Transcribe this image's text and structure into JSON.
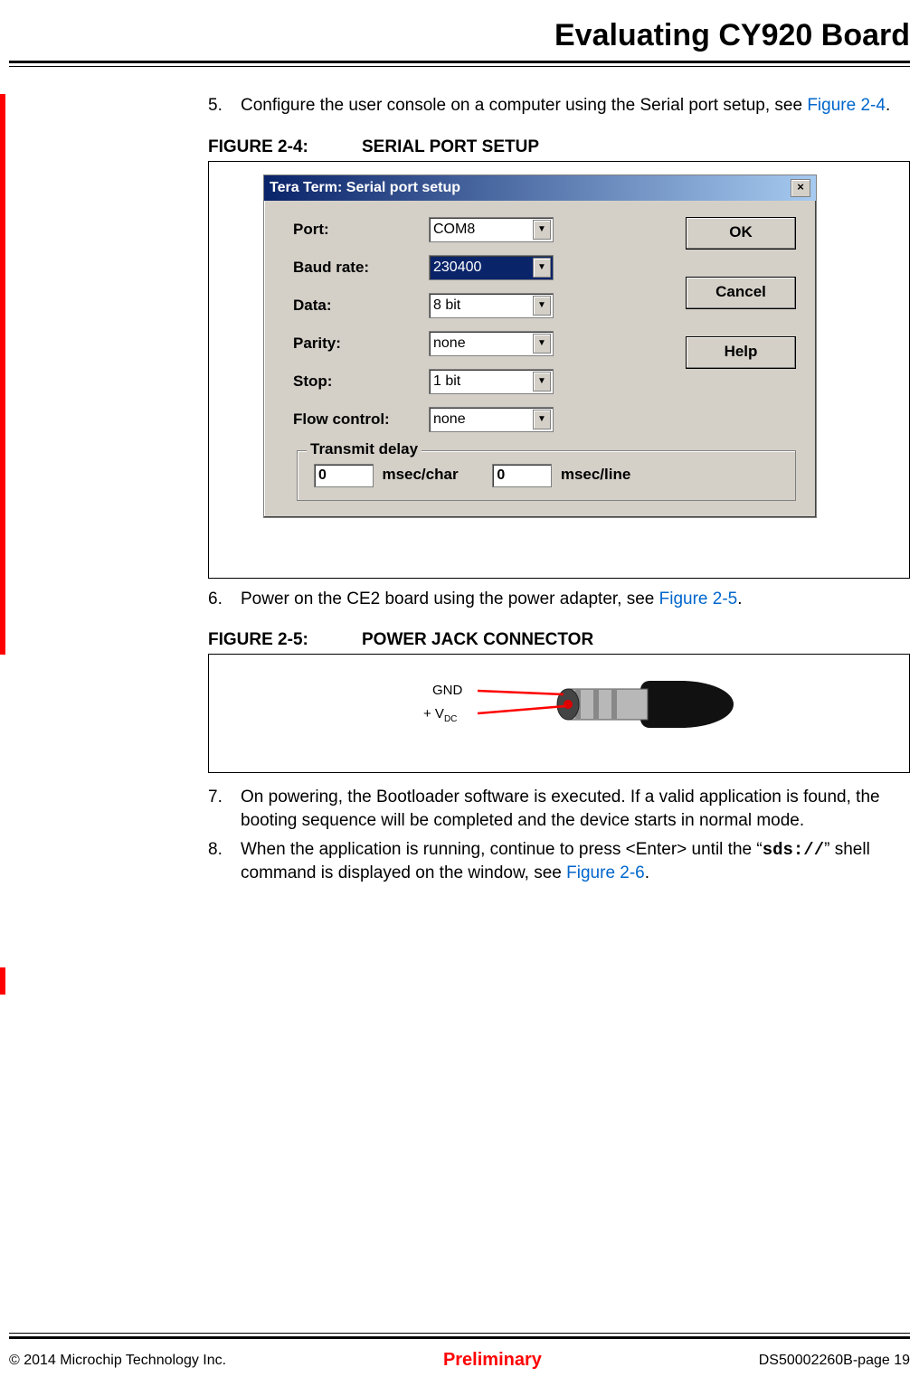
{
  "header": {
    "title": "Evaluating CY920 Board"
  },
  "steps": {
    "s5": {
      "num": "5.",
      "text_a": "Configure the user console on a computer using the Serial port setup, see ",
      "link": "Figure 2-4",
      "text_b": "."
    },
    "s6": {
      "num": "6.",
      "text_a": "Power on the CE2 board using the power adapter, see ",
      "link": "Figure 2-5",
      "text_b": "."
    },
    "s7": {
      "num": "7.",
      "text": "On powering, the Bootloader software is executed. If a valid application is found, the booting sequence will be completed and the device starts in normal mode."
    },
    "s8": {
      "num": "8.",
      "text_a": "When the application is running, continue to press <Enter> until the “",
      "code": "sds://",
      "text_b": "” shell command is displayed on the window, see ",
      "link": "Figure 2-6",
      "text_c": "."
    }
  },
  "figures": {
    "f24": {
      "label": "FIGURE 2-4:",
      "title": "SERIAL PORT SETUP"
    },
    "f25": {
      "label": "FIGURE 2-5:",
      "title": "POWER JACK CONNECTOR"
    }
  },
  "dialog": {
    "title": "Tera Term: Serial port setup",
    "close": "×",
    "labels": {
      "port": "Port:",
      "baud": "Baud rate:",
      "data": "Data:",
      "parity": "Parity:",
      "stop": "Stop:",
      "flow": "Flow control:"
    },
    "values": {
      "port": "COM8",
      "baud": "230400",
      "data": "8 bit",
      "parity": "none",
      "stop": "1 bit",
      "flow": "none"
    },
    "buttons": {
      "ok": "OK",
      "cancel": "Cancel",
      "help": "Help"
    },
    "fieldset": {
      "legend": "Transmit delay",
      "char_val": "0",
      "char_unit": "msec/char",
      "line_val": "0",
      "line_unit": "msec/line"
    }
  },
  "power_fig": {
    "gnd": "GND",
    "vdc": "+ V",
    "vdc_sub": "DC"
  },
  "footer": {
    "left": "© 2014 Microchip Technology Inc.",
    "center": "Preliminary",
    "right": "DS50002260B-page 19"
  }
}
